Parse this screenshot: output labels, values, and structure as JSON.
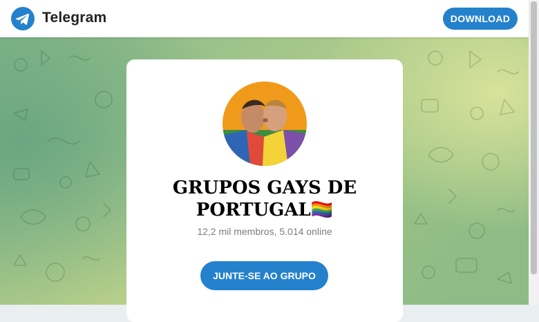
{
  "header": {
    "brand": "Telegram",
    "download_label": "DOWNLOAD"
  },
  "channel": {
    "title": "GRUPOS GAYS DE PORTUGAL🏳️‍🌈",
    "subtitle": "12,2 mil membros, 5.014 online",
    "join_label": "JUNTE-SE AO GRUPO"
  },
  "colors": {
    "accent": "#2481cc",
    "card_bg": "#ffffff",
    "subtitle_text": "#7c7c7c"
  },
  "icons": {
    "logo": "telegram-logo-icon"
  }
}
